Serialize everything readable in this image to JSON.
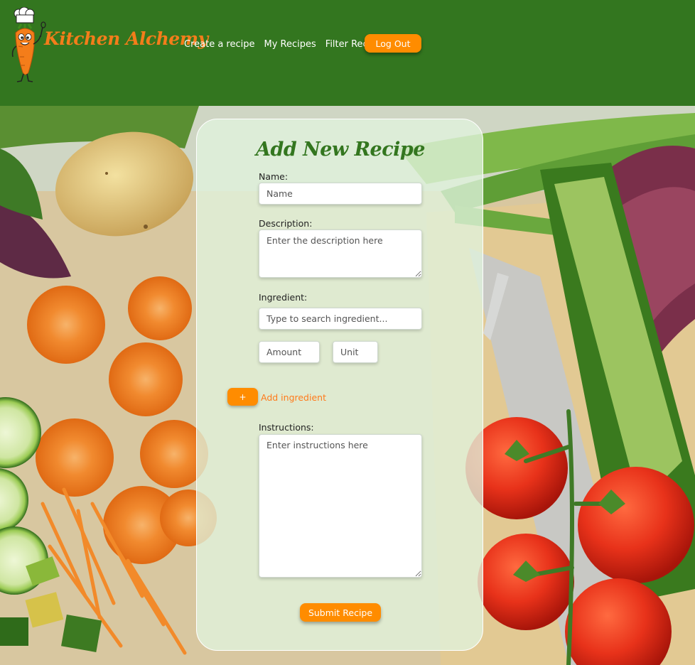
{
  "brand": {
    "name": "Kitchen Alchemy",
    "logo_icon": "carrot-chef-icon"
  },
  "nav": {
    "items": [
      {
        "label": "Create a recipe"
      },
      {
        "label": "My Recipes"
      },
      {
        "label": "Filter Recipes"
      }
    ],
    "logout_label": "Log Out"
  },
  "form": {
    "title": "Add New Recipe",
    "name_label": "Name:",
    "name_placeholder": "Name",
    "description_label": "Description:",
    "description_placeholder": "Enter the description here",
    "ingredient_label": "Ingredient:",
    "ingredient_placeholder": "Type to search ingredient...",
    "amount_placeholder": "Amount",
    "unit_placeholder": "Unit",
    "add_button_label": "+",
    "add_ingredient_label": "Add ingredient",
    "instructions_label": "Instructions:",
    "instructions_placeholder": "Enter instructions here",
    "submit_label": "Submit Recipe"
  },
  "colors": {
    "header_green": "#33761f",
    "accent_orange": "#ff8c00",
    "title_green": "#33761f"
  }
}
